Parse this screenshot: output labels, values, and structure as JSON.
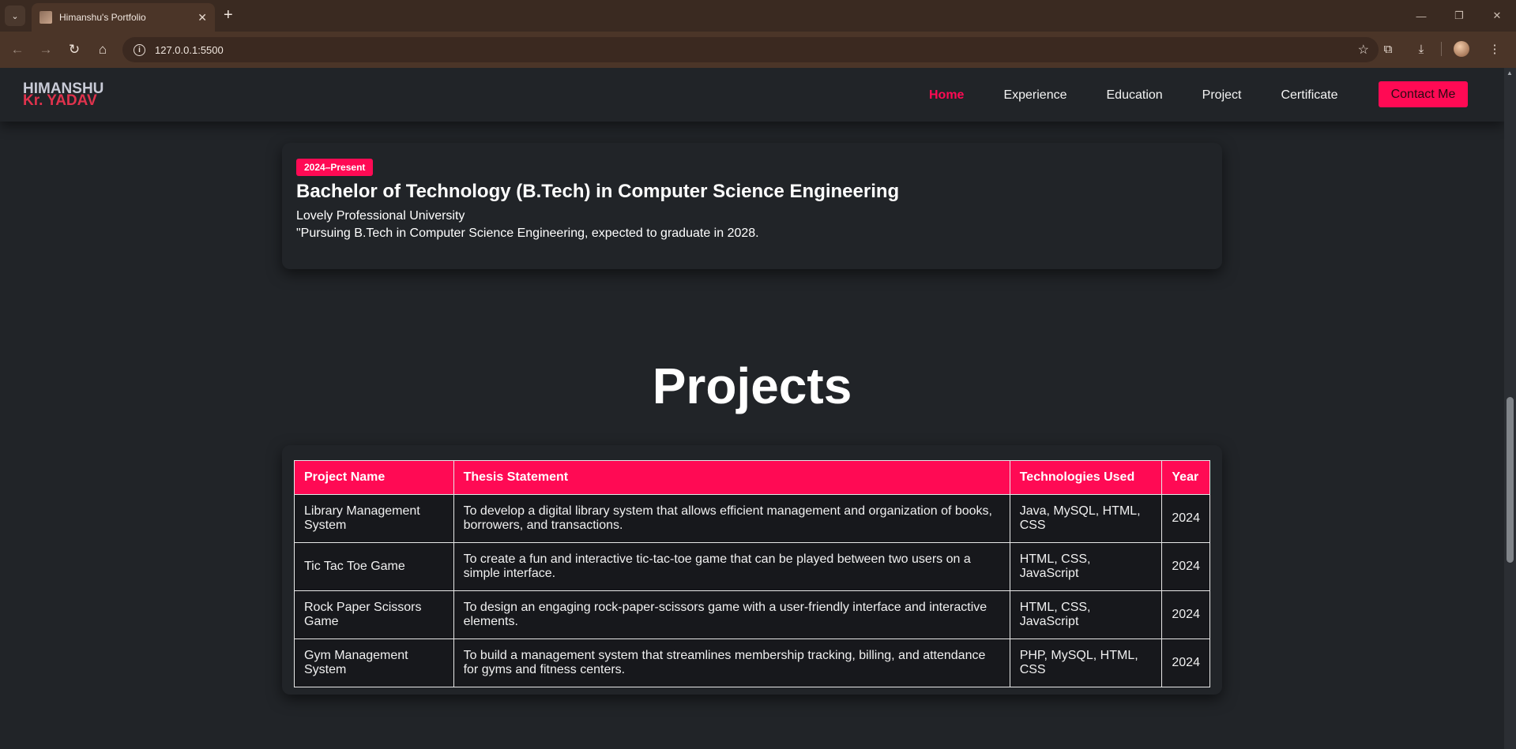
{
  "browser": {
    "tab_title": "Himanshu's Portfolio",
    "url": "127.0.0.1:5500",
    "new_tab_symbol": "+",
    "tab_close_symbol": "✕"
  },
  "site": {
    "logo_line1": "HIMANSHU",
    "logo_line2": "Kr. YADAV",
    "nav": [
      "Home",
      "Experience",
      "Education",
      "Project",
      "Certificate"
    ],
    "active_nav": "Home",
    "contact_label": "Contact Me",
    "accent_color": "#ff0a54"
  },
  "education": {
    "badge": "2024–Present",
    "title": "Bachelor of Technology (B.Tech) in Computer Science Engineering",
    "university": "Lovely Professional University",
    "description": "\"Pursuing B.Tech in Computer Science Engineering, expected to graduate in 2028."
  },
  "projects": {
    "heading": "Projects",
    "columns": [
      "Project Name",
      "Thesis Statement",
      "Technologies Used",
      "Year"
    ],
    "rows": [
      {
        "name": "Library Management System",
        "thesis": "To develop a digital library system that allows efficient management and organization of books, borrowers, and transactions.",
        "tech": "Java, MySQL, HTML, CSS",
        "year": "2024"
      },
      {
        "name": "Tic Tac Toe Game",
        "thesis": "To create a fun and interactive tic-tac-toe game that can be played between two users on a simple interface.",
        "tech": "HTML, CSS, JavaScript",
        "year": "2024"
      },
      {
        "name": "Rock Paper Scissors Game",
        "thesis": "To design an engaging rock-paper-scissors game with a user-friendly interface and interactive elements.",
        "tech": "HTML, CSS, JavaScript",
        "year": "2024"
      },
      {
        "name": "Gym Management System",
        "thesis": "To build a management system that streamlines membership tracking, billing, and attendance for gyms and fitness centers.",
        "tech": "PHP, MySQL, HTML, CSS",
        "year": "2024"
      }
    ]
  }
}
